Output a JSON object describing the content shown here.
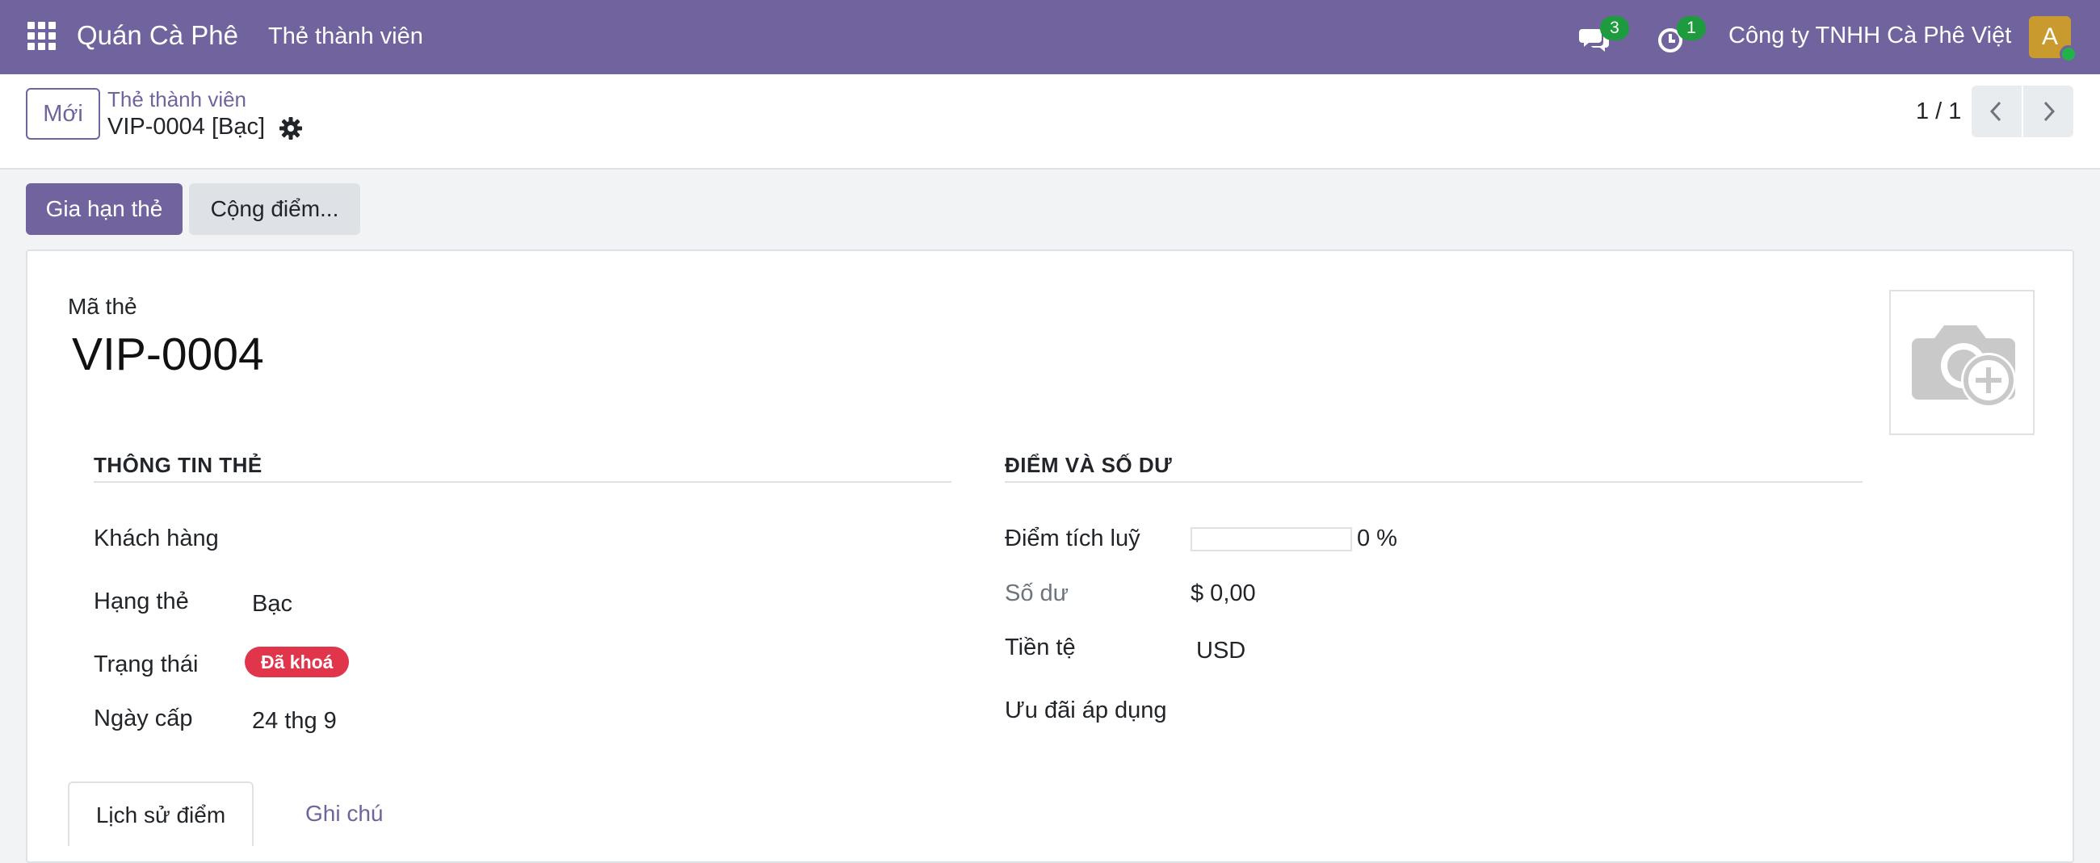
{
  "navbar": {
    "brand": "Quán Cà Phê",
    "menu_item": "Thẻ thành viên",
    "messages_count": "3",
    "activities_count": "1",
    "company": "Công ty TNHH Cà Phê Việt",
    "avatar_initial": "A"
  },
  "control_panel": {
    "new_button": "Mới",
    "breadcrumb": "Thẻ thành viên",
    "record_title": "VIP-0004 [Bạc]",
    "pager": "1 / 1"
  },
  "statusbar": {
    "primary_button": "Gia hạn thẻ",
    "secondary_button": "Cộng điểm..."
  },
  "form": {
    "code_label": "Mã thẻ",
    "code_value": "VIP-0004",
    "left_group": {
      "title": "THÔNG TIN THẺ",
      "customer_label": "Khách hàng",
      "customer_value": "",
      "tier_label": "Hạng thẻ",
      "tier_value": "Bạc",
      "status_label": "Trạng thái",
      "status_value": "Đã khoá",
      "issue_date_label": "Ngày cấp",
      "issue_date_value": "24 thg 9"
    },
    "right_group": {
      "title": "ĐIỂM VÀ SỐ DƯ",
      "points_label": "Điểm tích luỹ",
      "points_percent": 0,
      "points_value": "0 %",
      "balance_label": "Số dư",
      "balance_value": "$ 0,00",
      "currency_label": "Tiền tệ",
      "currency_value": "USD",
      "offers_label": "Ưu đãi áp dụng"
    },
    "tabs": [
      "Lịch sử điểm",
      "Ghi chú"
    ]
  },
  "colors": {
    "brand": "#71639e",
    "status_badge": "#e0354a",
    "badge_green": "#1e9b3e"
  }
}
